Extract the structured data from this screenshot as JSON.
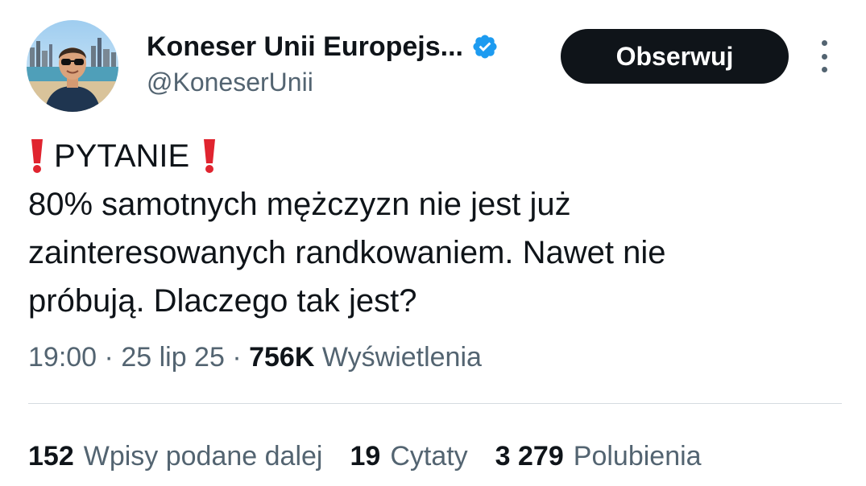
{
  "author": {
    "display_name": "Koneser Unii Europejs...",
    "handle": "@KoneserUnii",
    "avatar_icon": "profile-photo",
    "verified_icon": "verified-badge-icon",
    "verified_color": "#1d9bf0"
  },
  "follow_button": {
    "label": "Obserwuj"
  },
  "more_icon": "more-vertical-icon",
  "tweet": {
    "question_label": "PYTANIE",
    "emoji": "exclamation-icon",
    "lines": [
      "80% samotnych mężczyzn nie jest już",
      "zainteresowanych randkowaniem. Nawet nie",
      "próbują. Dlaczego tak jest?"
    ]
  },
  "meta": {
    "time": "19:00",
    "separator": "·",
    "date": "25 lip 25",
    "views_count": "756K",
    "views_label": "Wyświetlenia"
  },
  "stats": [
    {
      "count": "152",
      "label": "Wpisy podane dalej"
    },
    {
      "count": "19",
      "label": "Cytaty"
    },
    {
      "count": "3 279",
      "label": "Polubienia"
    }
  ],
  "colors": {
    "text": "#0f1419",
    "secondary": "#536471",
    "accent": "#1d9bf0",
    "exclamation": "#e0242f"
  }
}
